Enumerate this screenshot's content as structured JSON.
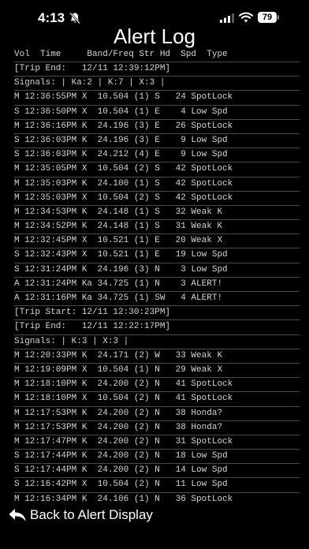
{
  "status_bar": {
    "time": "4:13",
    "battery": "79"
  },
  "title": "Alert Log",
  "log": {
    "header": "Vol  Time     Band/Freq Str Hd  Spd  Type",
    "lines": [
      "[Trip End:   12/11 12:39:12PM]",
      "Signals: | Ka:2 | K:7 | X:3 |",
      "M 12:36:55PM X  10.504 (1) S   24 SpotLock",
      "S 12:36:50PM X  10.504 (1) E    4 Low Spd",
      "M 12:36:16PM K  24.196 (3) E   26 SpotLock",
      "S 12:36:03PM K  24.196 (3) E    9 Low Spd",
      "S 12:36:03PM K  24.212 (4) E    9 Low Spd",
      "M 12:35:05PM X  10.504 (2) S   42 SpotLock",
      "M 12:35:03PM K  24.100 (1) S   42 SpotLock",
      "M 12:35:03PM X  10.504 (2) S   42 SpotLock",
      "M 12:34:53PM K  24.148 (1) S   32 Weak K",
      "M 12:34:52PM K  24.148 (1) S   31 Weak K",
      "M 12:32:45PM X  10.521 (1) E   20 Weak X",
      "S 12:32:43PM X  10.521 (1) E   19 Low Spd",
      "S 12:31:24PM K  24.196 (3) N    3 Low Spd",
      "A 12:31:24PM Ka 34.725 (1) N    3 ALERT!",
      "A 12:31:16PM Ka 34.725 (1) SW   4 ALERT!",
      "[Trip Start: 12/11 12:30:23PM]",
      "[Trip End:   12/11 12:22:17PM]",
      "Signals: | K:3 | X:3 |",
      "M 12:20:33PM K  24.171 (2) W   33 Weak K",
      "M 12:19:09PM X  10.504 (1) N   29 Weak X",
      "M 12:18:10PM K  24.200 (2) N   41 SpotLock",
      "M 12:18:10PM X  10.504 (2) N   41 SpotLock",
      "M 12:17:53PM K  24.200 (2) N   38 Honda?",
      "M 12:17:53PM K  24.200 (2) N   38 Honda?",
      "M 12:17:47PM K  24.200 (2) N   31 SpotLock",
      "S 12:17:44PM K  24.200 (2) N   18 Low Spd",
      "S 12:17:44PM K  24.200 (2) N   14 Low Spd",
      "S 12:16:42PM X  10.504 (2) N   11 Low Spd",
      "M 12:16:34PM K  24.106 (1) N   36 SpotLock"
    ]
  },
  "back_button": {
    "label": "Back to Alert Display"
  }
}
